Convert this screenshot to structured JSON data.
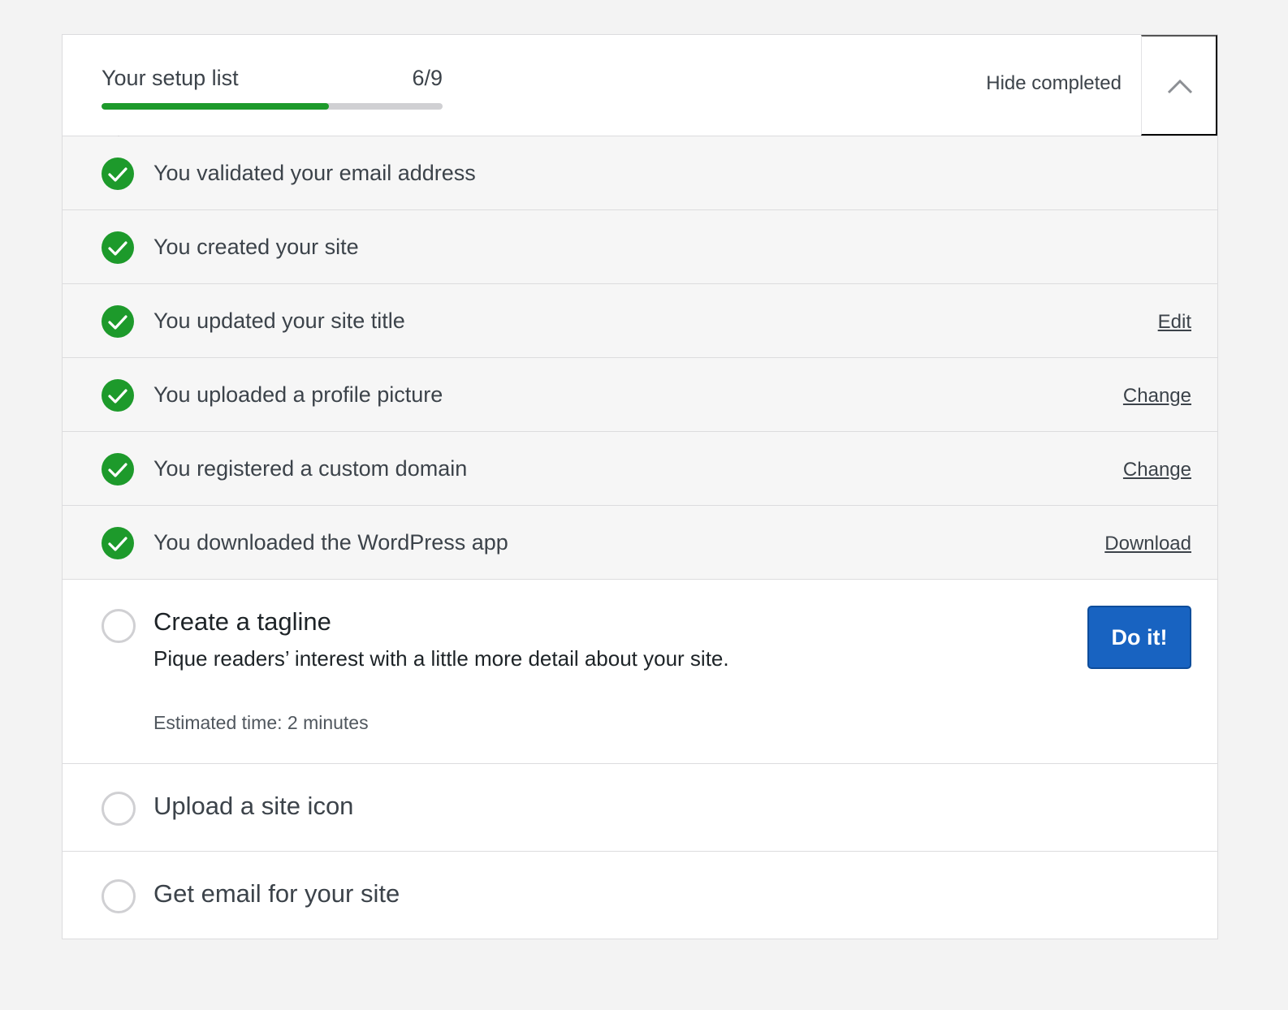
{
  "header": {
    "title": "Your setup list",
    "count": "6/9",
    "progress": 0.667,
    "hide_completed_label": "Hide completed",
    "collapse_icon": "chevron-up-icon"
  },
  "completed_tasks": [
    {
      "label": "You validated your email address",
      "action": ""
    },
    {
      "label": "You created your site",
      "action": ""
    },
    {
      "label": "You updated your site title",
      "action": "Edit"
    },
    {
      "label": "You uploaded a profile picture",
      "action": "Change"
    },
    {
      "label": "You registered a custom domain",
      "action": "Change"
    },
    {
      "label": "You downloaded the WordPress app",
      "action": "Download"
    }
  ],
  "active_task": {
    "title": "Create a tagline",
    "description": "Pique readers’ interest with a little more detail about your site.",
    "estimated_time": "Estimated time: 2 minutes",
    "button_label": "Do it!"
  },
  "pending_tasks": [
    {
      "label": "Upload a site icon"
    },
    {
      "label": "Get email for your site"
    }
  ],
  "colors": {
    "progress": "#1d9a2b",
    "check": "#1d9a2b",
    "primary_button": "#1863c1",
    "completed_bg": "#f6f6f6"
  }
}
